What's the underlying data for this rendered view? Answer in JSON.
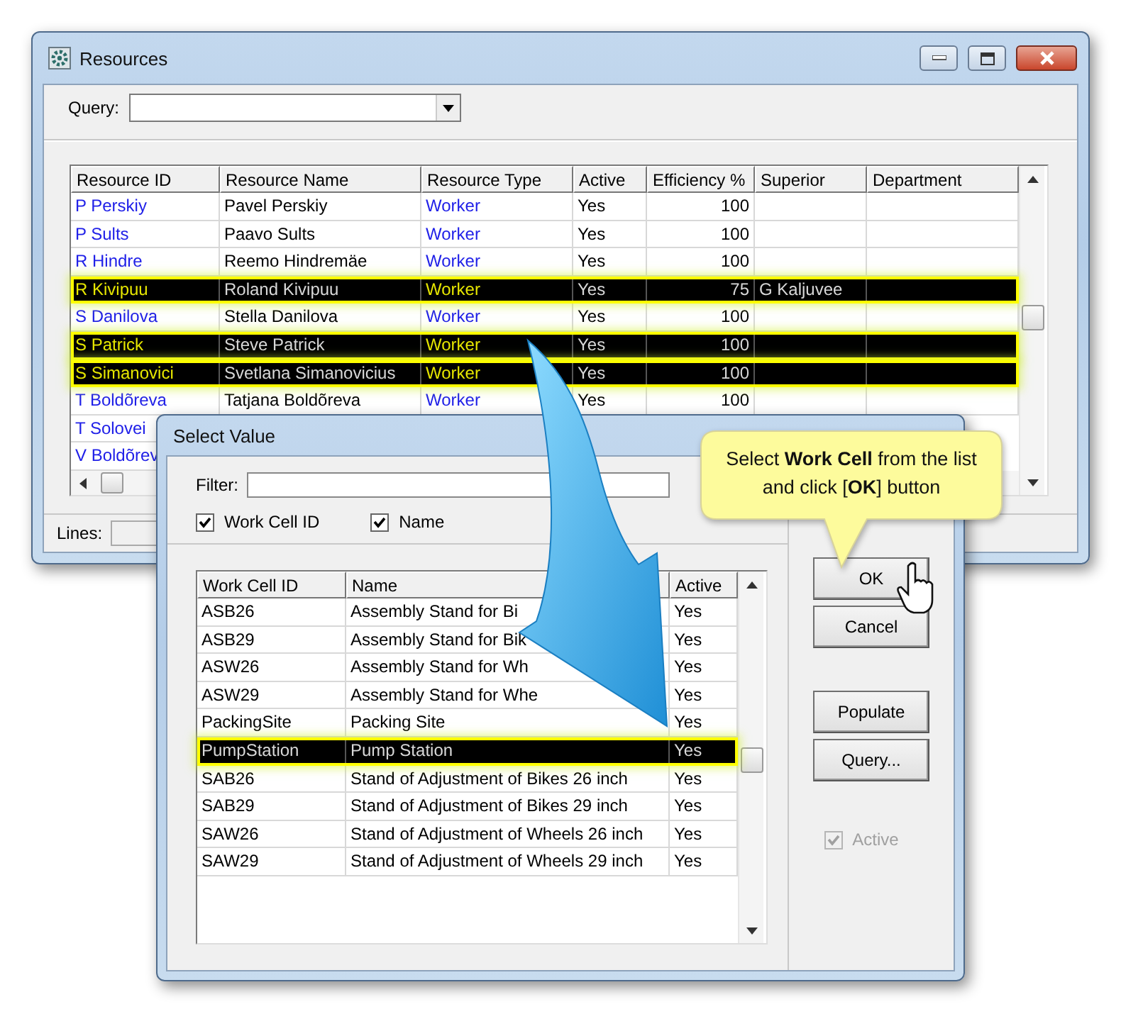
{
  "main_window": {
    "title": "Resources",
    "query_label": "Query:",
    "table": {
      "columns": [
        "Resource ID",
        "Resource Name",
        "Resource Type",
        "Active",
        "Efficiency %",
        "Superior",
        "Department"
      ],
      "rows": [
        {
          "cells": [
            "P Perskiy",
            "Pavel Perskiy",
            "Worker",
            "Yes",
            "100",
            "",
            ""
          ],
          "selected": false
        },
        {
          "cells": [
            "P Sults",
            "Paavo Sults",
            "Worker",
            "Yes",
            "100",
            "",
            ""
          ],
          "selected": false
        },
        {
          "cells": [
            "R Hindre",
            "Reemo Hindremäe",
            "Worker",
            "Yes",
            "100",
            "",
            ""
          ],
          "selected": false
        },
        {
          "cells": [
            "R Kivipuu",
            "Roland Kivipuu",
            "Worker",
            "Yes",
            "75",
            "G Kaljuvee",
            ""
          ],
          "selected": true
        },
        {
          "cells": [
            "S Danilova",
            "Stella Danilova",
            "Worker",
            "Yes",
            "100",
            "",
            ""
          ],
          "selected": false
        },
        {
          "cells": [
            "S Patrick",
            "Steve Patrick",
            "Worker",
            "Yes",
            "100",
            "",
            ""
          ],
          "selected": true
        },
        {
          "cells": [
            "S Simanovici",
            "Svetlana Simanovicius",
            "Worker",
            "Yes",
            "100",
            "",
            ""
          ],
          "selected": true
        },
        {
          "cells": [
            "T Boldõreva",
            "Tatjana Boldõreva",
            "Worker",
            "Yes",
            "100",
            "",
            ""
          ],
          "selected": false
        },
        {
          "cells": [
            "T Solovei"
          ],
          "selected": false
        },
        {
          "cells": [
            "V Boldõrev"
          ],
          "selected": false
        }
      ]
    },
    "lines_label": "Lines:"
  },
  "dialog": {
    "title": "Select Value",
    "filter_label": "Filter:",
    "checkboxes": [
      {
        "label": "Work Cell ID",
        "checked": true
      },
      {
        "label": "Name",
        "checked": true
      }
    ],
    "list": {
      "columns": [
        "Work Cell ID",
        "Name",
        "Active"
      ],
      "rows": [
        {
          "cells": [
            "ASB26",
            "Assembly Stand for Bi",
            "Yes"
          ],
          "selected": false
        },
        {
          "cells": [
            "ASB29",
            "Assembly Stand for Bik",
            "Yes"
          ],
          "selected": false
        },
        {
          "cells": [
            "ASW26",
            "Assembly Stand for Wh",
            "Yes"
          ],
          "selected": false
        },
        {
          "cells": [
            "ASW29",
            "Assembly Stand for Whe",
            "Yes"
          ],
          "selected": false
        },
        {
          "cells": [
            "PackingSite",
            "Packing Site",
            "Yes"
          ],
          "selected": false
        },
        {
          "cells": [
            "PumpStation",
            "Pump Station",
            "Yes"
          ],
          "selected": true
        },
        {
          "cells": [
            "SAB26",
            "Stand of Adjustment of Bikes 26 inch",
            "Yes"
          ],
          "selected": false
        },
        {
          "cells": [
            "SAB29",
            "Stand of Adjustment of Bikes 29 inch",
            "Yes"
          ],
          "selected": false
        },
        {
          "cells": [
            "SAW26",
            "Stand of Adjustment of Wheels 26 inch",
            "Yes"
          ],
          "selected": false
        },
        {
          "cells": [
            "SAW29",
            "Stand of Adjustment of Wheels 29 inch",
            "Yes"
          ],
          "selected": false
        }
      ]
    },
    "buttons": [
      {
        "label": "OK"
      },
      {
        "label": "Cancel"
      },
      {
        "label": "Populate"
      },
      {
        "label": "Query..."
      }
    ],
    "active_option": {
      "label": "Active",
      "checked": true,
      "disabled": true
    }
  },
  "callout": {
    "text": "Select **Work Cell** from the list and click [**OK**] button"
  }
}
